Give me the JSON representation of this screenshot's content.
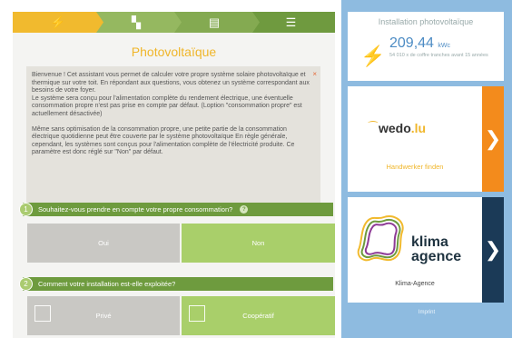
{
  "wizard": {
    "steps": [
      {
        "name": "energy",
        "icon": "bolt-icon",
        "glyph": "⚡"
      },
      {
        "name": "house",
        "icon": "house-icon",
        "glyph": "▚"
      },
      {
        "name": "money",
        "icon": "banknote-icon",
        "glyph": "▤"
      },
      {
        "name": "summary",
        "icon": "checklist-icon",
        "glyph": "☰"
      }
    ],
    "title": "Photovoltaïque",
    "info": {
      "paragraph1": "Bienvenue ! Cet assistant vous permet de calculer votre propre système solaire photovoltaïque et thermique sur votre toit. En répondant aux questions, vous obtenez un système correspondant aux besoins de votre foyer.",
      "paragraph2": "Le système sera conçu pour l'alimentation complète du rendement électrique, une éventuelle consommation propre n'est pas prise en compte par défaut. (Loption \"consommation propre\" est actuellement désactivée)",
      "paragraph3": "Même sans optimisation de la consommation propre, une petite partie de la consommation électrique quotidienne peut être couverte par le système photovoltaïque En règle générale, cependant, les systèmes sont conçus pour l'alimentation complète de l'électricité produite. Ce paramètre est donc réglé sur \"Non\" par défaut.",
      "close_glyph": "×"
    },
    "question1": {
      "number": "1",
      "text": "Souhaitez-vous prendre en compte votre propre consommation?",
      "help_glyph": "?",
      "options": [
        "Oui",
        "Non"
      ],
      "selected": "Non"
    },
    "question2": {
      "number": "2",
      "text": "Comment votre installation est-elle exploitée?",
      "options": [
        "Privé",
        "Coopératif"
      ],
      "selected": "Coopératif"
    }
  },
  "sidebar": {
    "install": {
      "title": "Installation photovoltaïque",
      "value": "209,44",
      "unit": "kWc",
      "subtitle": "54 010 x de coffre tranches avant 15 années"
    },
    "wedo": {
      "logo_main": "wedo",
      "logo_suffix": ".lu",
      "link": "Handwerker finden",
      "arrow": "❯"
    },
    "klima": {
      "logo_line1": "klima",
      "logo_line2": "agence",
      "name": "Klima-Agence",
      "arrow": "❯"
    },
    "footer": "Imprint"
  },
  "colors": {
    "yellow": "#f1ba2e",
    "green_dark": "#6e9b3e",
    "green_light": "#a9cf6a",
    "gray_option": "#c9c8c4",
    "orange": "#f38b1c",
    "navy": "#1b3a57",
    "sky": "#8ebbe0"
  }
}
